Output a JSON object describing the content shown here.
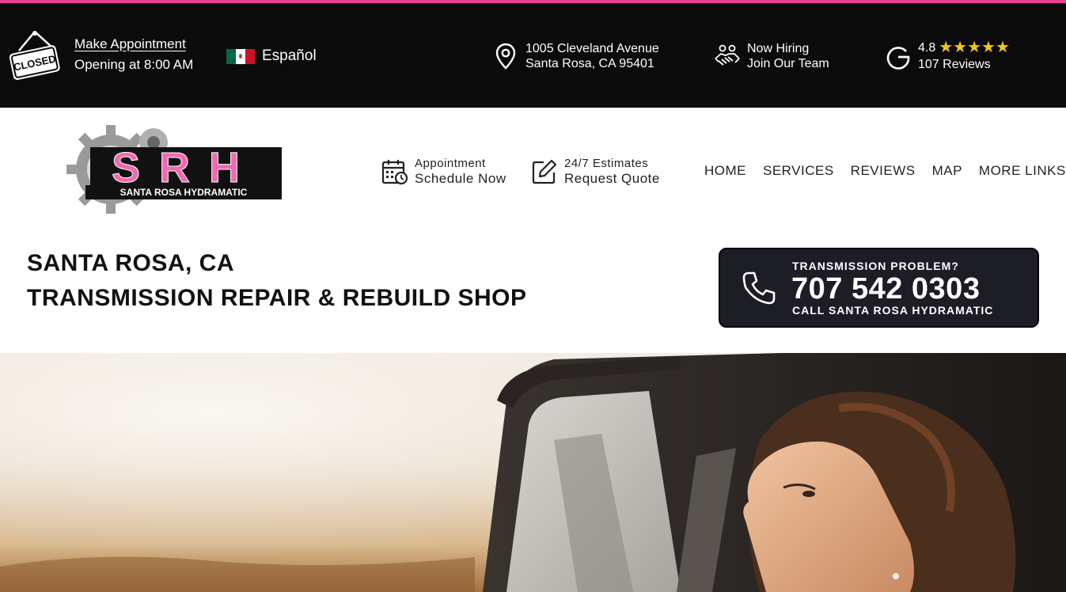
{
  "topbar": {
    "closed_sign": "CLOSED",
    "appointment_link": "Make Appointment",
    "opening": "Opening at 8:00 AM",
    "language": "Español",
    "address_line1": "1005 Cleveland Avenue",
    "address_line2": "Santa Rosa, CA 95401",
    "hiring_line1": "Now Hiring",
    "hiring_line2": "Join Our Team",
    "rating": "4.8",
    "stars": "★★★★★",
    "reviews": "107 Reviews"
  },
  "logo": {
    "letters": "SRH",
    "tagline": "SANTA ROSA HYDRAMATIC"
  },
  "nav": {
    "cta_appointment_small": "Appointment",
    "cta_appointment_big": "Schedule Now",
    "cta_quote_small": "24/7 Estimates",
    "cta_quote_big": "Request Quote",
    "menu": [
      "HOME",
      "SERVICES",
      "REVIEWS",
      "MAP",
      "MORE LINKS"
    ]
  },
  "headline": {
    "line1": "SANTA ROSA, CA",
    "line2": "TRANSMISSION REPAIR & REBUILD SHOP"
  },
  "call_box": {
    "pre": "TRANSMISSION PROBLEM?",
    "number": "707 542 0303",
    "post": "CALL SANTA ROSA HYDRAMATIC"
  },
  "colors": {
    "accent": "#e6428f",
    "topbar_bg": "#0b0b0b",
    "call_box_bg": "#1d1d26",
    "star": "#f5c518"
  },
  "icons": {
    "closed": "closed-sign-icon",
    "flag": "mexico-flag-icon",
    "address": "map-pin-icon",
    "hiring": "handshake-icon",
    "reviews": "google-icon",
    "appointment": "calendar-clock-icon",
    "quote": "edit-pencil-icon",
    "phone": "phone-icon"
  }
}
